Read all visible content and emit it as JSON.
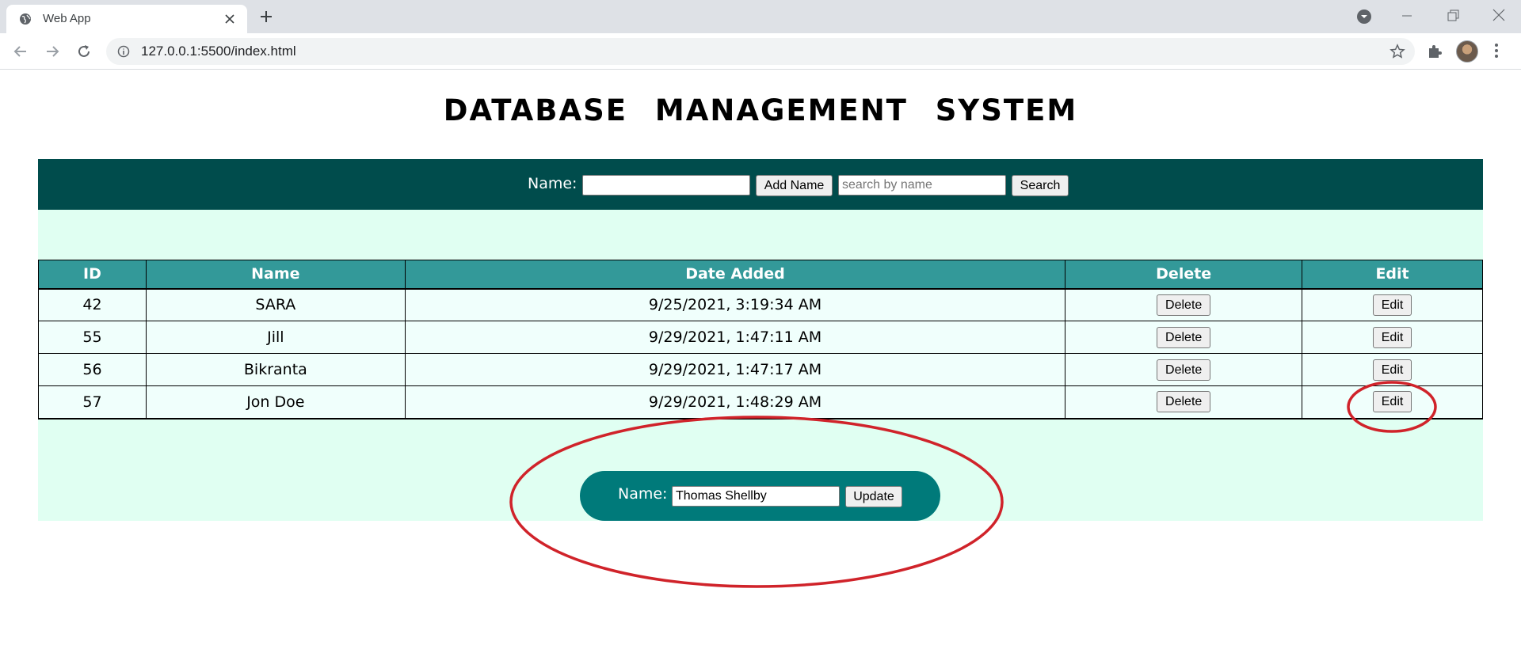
{
  "browser": {
    "tab_title": "Web App",
    "url": "127.0.0.1:5500/index.html"
  },
  "page": {
    "title": "DATABASE MANAGEMENT SYSTEM"
  },
  "add_bar": {
    "label": "Name:",
    "name_value": "",
    "add_button": "Add Name",
    "search_placeholder": "search by name",
    "search_button": "Search"
  },
  "table": {
    "headers": [
      "ID",
      "Name",
      "Date Added",
      "Delete",
      "Edit"
    ],
    "rows": [
      {
        "id": "42",
        "name": "SARA",
        "date": "9/25/2021, 3:19:34 AM",
        "delete": "Delete",
        "edit": "Edit"
      },
      {
        "id": "55",
        "name": "Jill",
        "date": "9/29/2021, 1:47:11 AM",
        "delete": "Delete",
        "edit": "Edit"
      },
      {
        "id": "56",
        "name": "Bikranta",
        "date": "9/29/2021, 1:47:17 AM",
        "delete": "Delete",
        "edit": "Edit"
      },
      {
        "id": "57",
        "name": "Jon Doe",
        "date": "9/29/2021, 1:48:29 AM",
        "delete": "Delete",
        "edit": "Edit"
      }
    ]
  },
  "update_form": {
    "label": "Name:",
    "value": "Thomas Shellby",
    "button": "Update"
  },
  "colors": {
    "header_bar": "#004c4c",
    "table_header": "#339999",
    "panel_bg": "#e0fff2",
    "update_pill": "#007a7a",
    "annotation": "#d0232a"
  }
}
